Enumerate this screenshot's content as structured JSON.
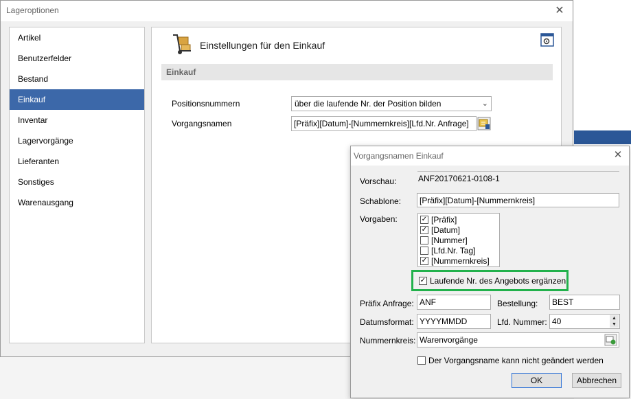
{
  "main_dialog": {
    "title": "Lageroptionen",
    "close_glyph": "✕",
    "nav_items": [
      "Artikel",
      "Benutzerfelder",
      "Bestand",
      "Einkauf",
      "Inventar",
      "Lagervorgänge",
      "Lieferanten",
      "Sonstiges",
      "Warenausgang"
    ],
    "selected_nav": "Einkauf",
    "section_title": "Einstellungen für den Einkauf",
    "section_band": "Einkauf",
    "positionsnummern_label": "Positionsnummern",
    "positionsnummern_value": "über die laufende Nr. der Position bilden",
    "vorgangsnamen_label": "Vorgangsnamen",
    "vorgangsnamen_value": "[Präfix][Datum]-[Nummernkreis][Lfd.Nr. Anfrage]"
  },
  "sub_dialog": {
    "title": "Vorgangsnamen Einkauf",
    "close_glyph": "✕",
    "vorschau_label": "Vorschau:",
    "vorschau_value": "ANF20170621-0108-1",
    "schablone_label": "Schablone:",
    "schablone_value": "[Präfix][Datum]-[Nummernkreis]",
    "vorgaben_label": "Vorgaben:",
    "vorgaben": [
      {
        "label": "[Präfix]",
        "checked": true
      },
      {
        "label": "[Datum]",
        "checked": true
      },
      {
        "label": "[Nummer]",
        "checked": false
      },
      {
        "label": "[Lfd.Nr. Tag]",
        "checked": false
      },
      {
        "label": "[Nummernkreis]",
        "checked": true
      }
    ],
    "laufende_label": "Laufende Nr. des Angebots ergänzen",
    "laufende_checked": true,
    "praefix_label": "Präfix Anfrage:",
    "praefix_value": "ANF",
    "bestellung_label": "Bestellung:",
    "bestellung_value": "BEST",
    "datumsformat_label": "Datumsformat:",
    "datumsformat_value": "YYYYMMDD",
    "lfd_label": "Lfd. Nummer:",
    "lfd_value": "40",
    "nummernkreis_label": "Nummernkreis:",
    "nummernkreis_value": "Warenvorgänge",
    "locked_label": "Der Vorgangsname kann nicht geändert werden",
    "locked_checked": false,
    "ok_label": "OK",
    "cancel_label": "Abbrechen"
  },
  "colors": {
    "selected_nav": "#3c68a9",
    "highlight_border": "#22b14c",
    "band": "#e6e6e6"
  }
}
